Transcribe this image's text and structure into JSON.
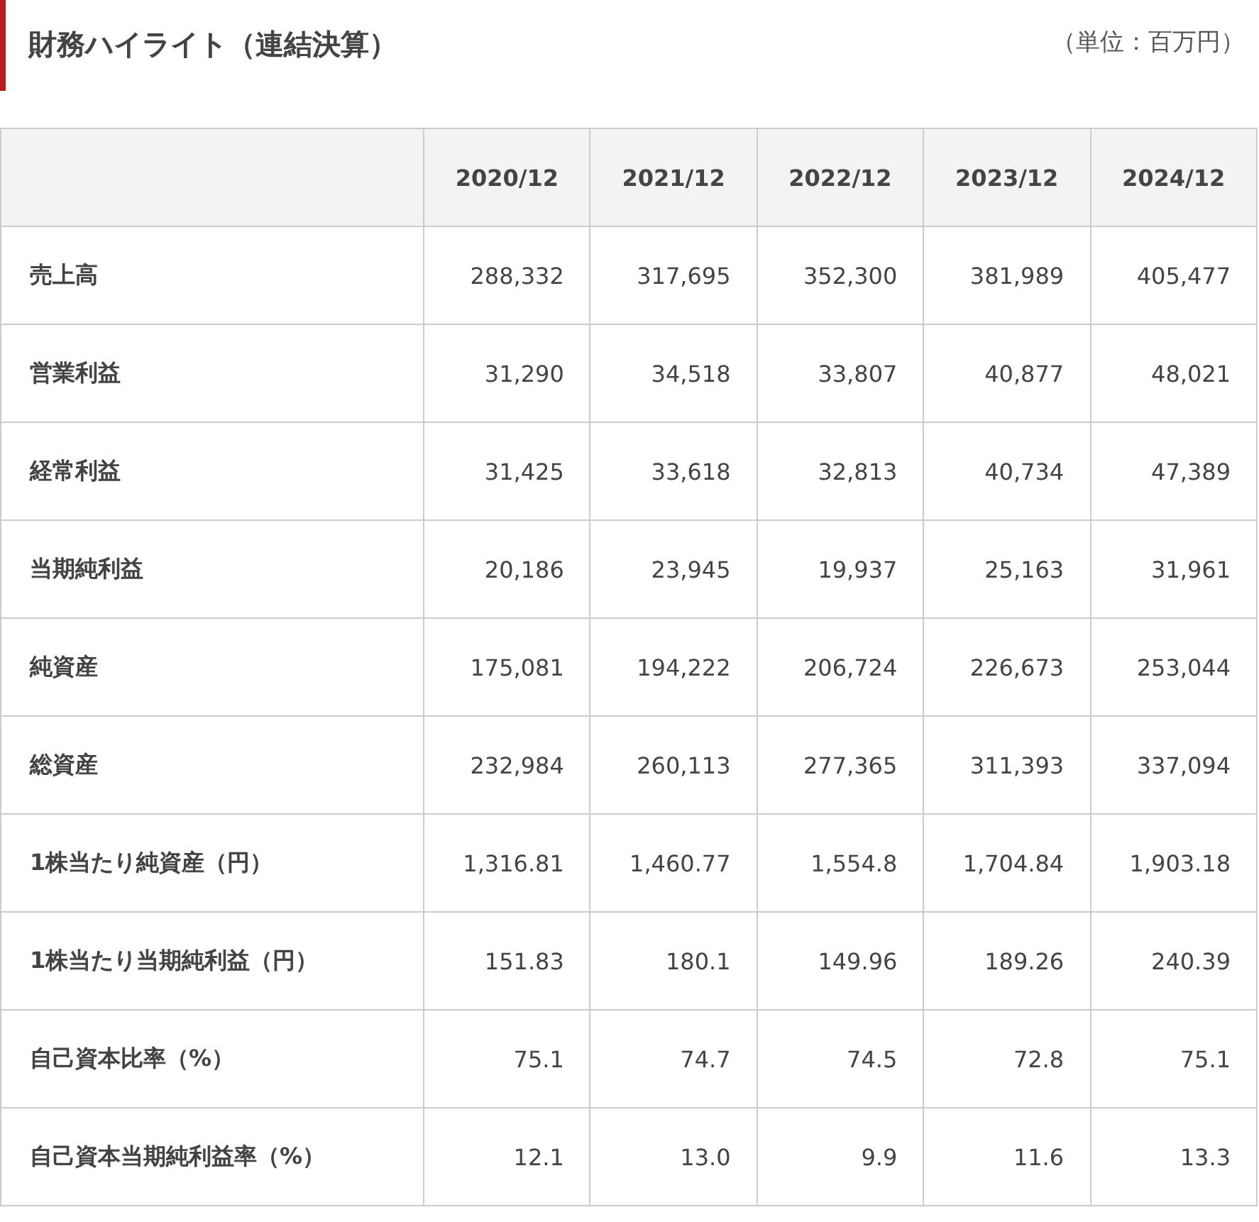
{
  "title": "財務ハイライト（連結決算）",
  "unit": "（単位：百万円）",
  "table": {
    "columns": [
      "2020/12",
      "2021/12",
      "2022/12",
      "2023/12",
      "2024/12"
    ],
    "rows": [
      {
        "label": "売上高",
        "values": [
          "288,332",
          "317,695",
          "352,300",
          "381,989",
          "405,477"
        ]
      },
      {
        "label": "営業利益",
        "values": [
          "31,290",
          "34,518",
          "33,807",
          "40,877",
          "48,021"
        ]
      },
      {
        "label": "経常利益",
        "values": [
          "31,425",
          "33,618",
          "32,813",
          "40,734",
          "47,389"
        ]
      },
      {
        "label": "当期純利益",
        "values": [
          "20,186",
          "23,945",
          "19,937",
          "25,163",
          "31,961"
        ]
      },
      {
        "label": "純資産",
        "values": [
          "175,081",
          "194,222",
          "206,724",
          "226,673",
          "253,044"
        ]
      },
      {
        "label": "総資産",
        "values": [
          "232,984",
          "260,113",
          "277,365",
          "311,393",
          "337,094"
        ]
      },
      {
        "label": "1株当たり純資産（円）",
        "values": [
          "1,316.81",
          "1,460.77",
          "1,554.8",
          "1,704.84",
          "1,903.18"
        ]
      },
      {
        "label": "1株当たり当期純利益（円）",
        "values": [
          "151.83",
          "180.1",
          "149.96",
          "189.26",
          "240.39"
        ]
      },
      {
        "label": "自己資本比率（%）",
        "values": [
          "75.1",
          "74.7",
          "74.5",
          "72.8",
          "75.1"
        ]
      },
      {
        "label": "自己資本当期純利益率（%）",
        "values": [
          "12.1",
          "13.0",
          "9.9",
          "11.6",
          "13.3"
        ]
      }
    ]
  }
}
